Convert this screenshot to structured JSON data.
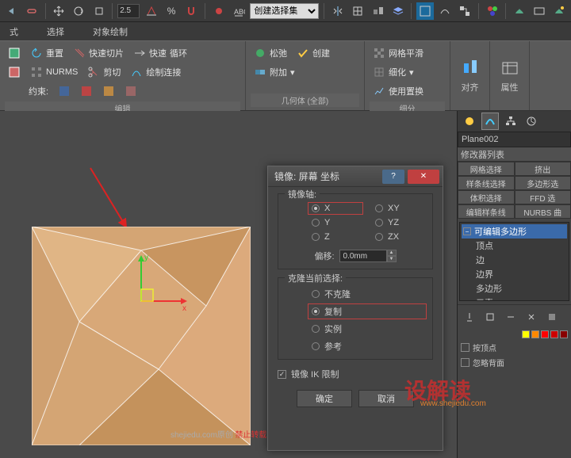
{
  "toolbar": {
    "spinner_angle": "2.5",
    "percent": "%",
    "selection_set": "创建选择集"
  },
  "tabs": [
    "式",
    "选择",
    "对象绘制"
  ],
  "ribbon": {
    "group1": {
      "reset": "重置",
      "fastcut": "快速切片",
      "fast": "快速",
      "loop": "循环",
      "nurms": "NURMS",
      "scissors": "剪切",
      "paintconn": "绘制连接",
      "constraint": "约束:",
      "label": "编辑"
    },
    "group2": {
      "relax": "松弛",
      "create": "创建",
      "attach": "附加",
      "label": "几何体 (全部)"
    },
    "group3": {
      "meshsmooth": "网格平滑",
      "refine": "细化",
      "usetrans": "使用置换",
      "label": "细分"
    },
    "align": "对齐",
    "props": "属性"
  },
  "dialog": {
    "title": "镜像: 屏幕 坐标",
    "axis_legend": "镜像轴:",
    "axes": {
      "x": "X",
      "y": "Y",
      "z": "Z",
      "xy": "XY",
      "yz": "YZ",
      "zx": "ZX"
    },
    "offset_label": "偏移:",
    "offset_value": "0.0mm",
    "clone_legend": "克隆当前选择:",
    "clone": {
      "none": "不克隆",
      "copy": "复制",
      "instance": "实例",
      "reference": "参考"
    },
    "ik_label": "镜像 IK 限制",
    "ok": "确定",
    "cancel": "取消"
  },
  "side": {
    "obj_name": "Plane002",
    "mod_list_title": "修改器列表",
    "mods": [
      "网格选择",
      "挤出",
      "样条线选择",
      "多边形选",
      "体积选择",
      "FFD 选",
      "编辑样条线",
      "NURBS 曲"
    ],
    "stack_top": "可编辑多边形",
    "subs": [
      "顶点",
      "边",
      "边界",
      "多边形",
      "元素"
    ],
    "opts": [
      "按顶点",
      "忽略背面"
    ]
  },
  "watermark": {
    "big": "设解读",
    "url": "www.shejiedu.com",
    "bottom": "shejiedu.com原创",
    "bottom_red": "禁止转载"
  }
}
